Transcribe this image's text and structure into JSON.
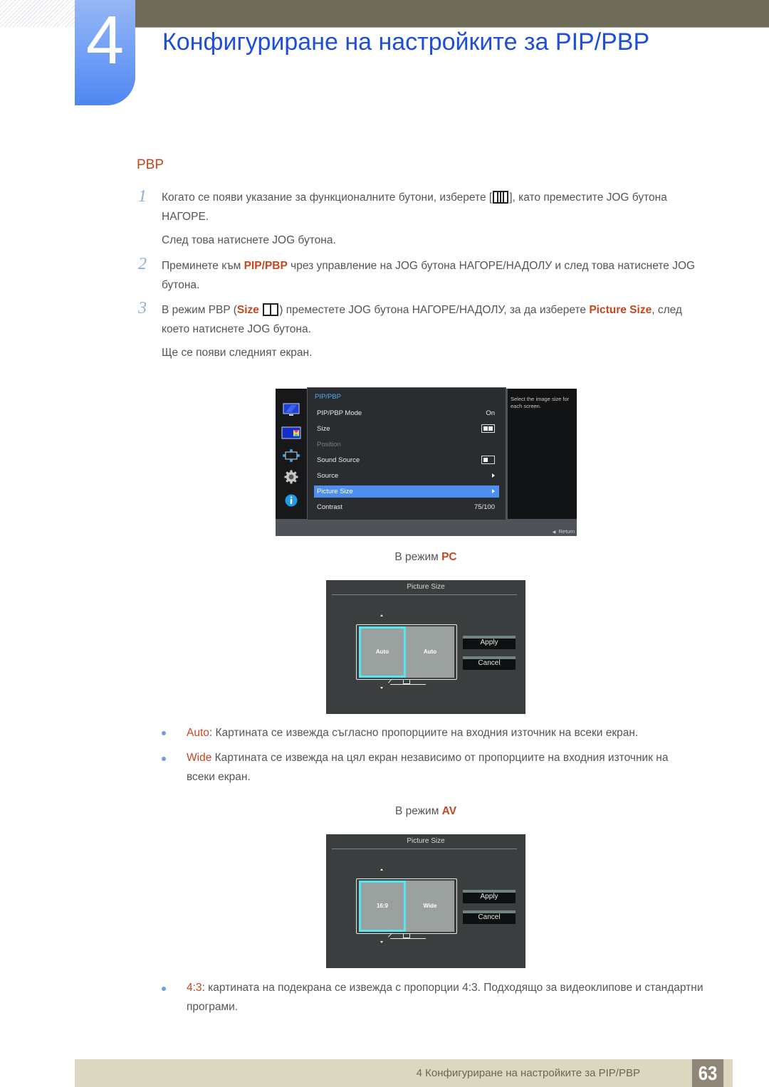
{
  "header": {
    "chapter_number": "4",
    "title": "Конфигуриране на настройките за PIP/PBP"
  },
  "section": {
    "title": "PBP"
  },
  "steps": [
    {
      "num": "1",
      "text_a": "Когато се появи указание за функционалните бутони, изберете [",
      "icon": "three-pane-monitor-icon",
      "text_b": "], като преместите JOG бутона НАГОРЕ.",
      "followup": "След това натиснете JOG бутона."
    },
    {
      "num": "2",
      "text_a": "Преминете към ",
      "highlight": "PIP/PBP",
      "text_b": " чрез управление на JOG бутона НАГОРЕ/НАДОЛУ и след това натиснете JOG бутона."
    },
    {
      "num": "3",
      "text_a": "В режим PBP (",
      "highlight_a": "Size",
      "icon": "two-pane-icon",
      "text_b": ") преместете JOG бутона НАГОРЕ/НАДОЛУ, за да изберете ",
      "highlight_b": "Picture Size",
      "text_c": ", след което натиснете JOG бутона.",
      "followup": "Ще се появи следният екран."
    }
  ],
  "osd": {
    "menu_title": "PIP/PBP",
    "items": [
      {
        "label": "PIP/PBP Mode",
        "value": "On",
        "state": "normal"
      },
      {
        "label": "Size",
        "value_icon": "two-pane-icon",
        "state": "normal"
      },
      {
        "label": "Position",
        "state": "disabled"
      },
      {
        "label": "Sound Source",
        "value_icon": "left-pane-icon",
        "state": "normal"
      },
      {
        "label": "Source",
        "value_icon": "arrow-right-icon",
        "state": "normal"
      },
      {
        "label": "Picture Size",
        "value_icon": "arrow-right-icon",
        "state": "selected"
      },
      {
        "label": "Contrast",
        "value": "75/100",
        "state": "normal"
      }
    ],
    "help_text": "Select the image size for each screen.",
    "return_label": "Return",
    "sidebar_icons": [
      "picture-icon",
      "color-icon",
      "size-position-icon",
      "setup-icon",
      "information-icon"
    ]
  },
  "pc_mode": {
    "label_prefix": "В режим ",
    "label_mode": "PC",
    "dialog": {
      "title": "Picture Size",
      "left_pane": "Auto",
      "right_pane": "Auto",
      "apply": "Apply",
      "cancel": "Cancel"
    },
    "bullets": [
      {
        "term": "Auto",
        "sep": ":",
        "text": " Картината се извежда съгласно пропорциите на входния източник на всеки екран."
      },
      {
        "term": "Wide",
        "sep": "",
        "text": " Картината се извежда на цял екран независимо от пропорциите на входния източник на всеки екран."
      }
    ]
  },
  "av_mode": {
    "label_prefix": "В режим ",
    "label_mode": "AV",
    "dialog": {
      "title": "Picture Size",
      "left_pane": "16:9",
      "right_pane": "Wide",
      "apply": "Apply",
      "cancel": "Cancel"
    },
    "bullets": [
      {
        "term": "4:3",
        "sep": ":",
        "text": " картината на подекрана се извежда с пропорции 4:3. Подходящо за видеоклипове и стандартни програми."
      }
    ]
  },
  "footer": {
    "text": "4 Конфигуриране на настройките за PIP/PBP",
    "page_number": "63"
  },
  "colors": {
    "title_blue": "#1e4fd6",
    "accent_orange": "#c8461e",
    "osd_selected": "#4e8ef0",
    "pane_highlight": "#55e6ef"
  }
}
